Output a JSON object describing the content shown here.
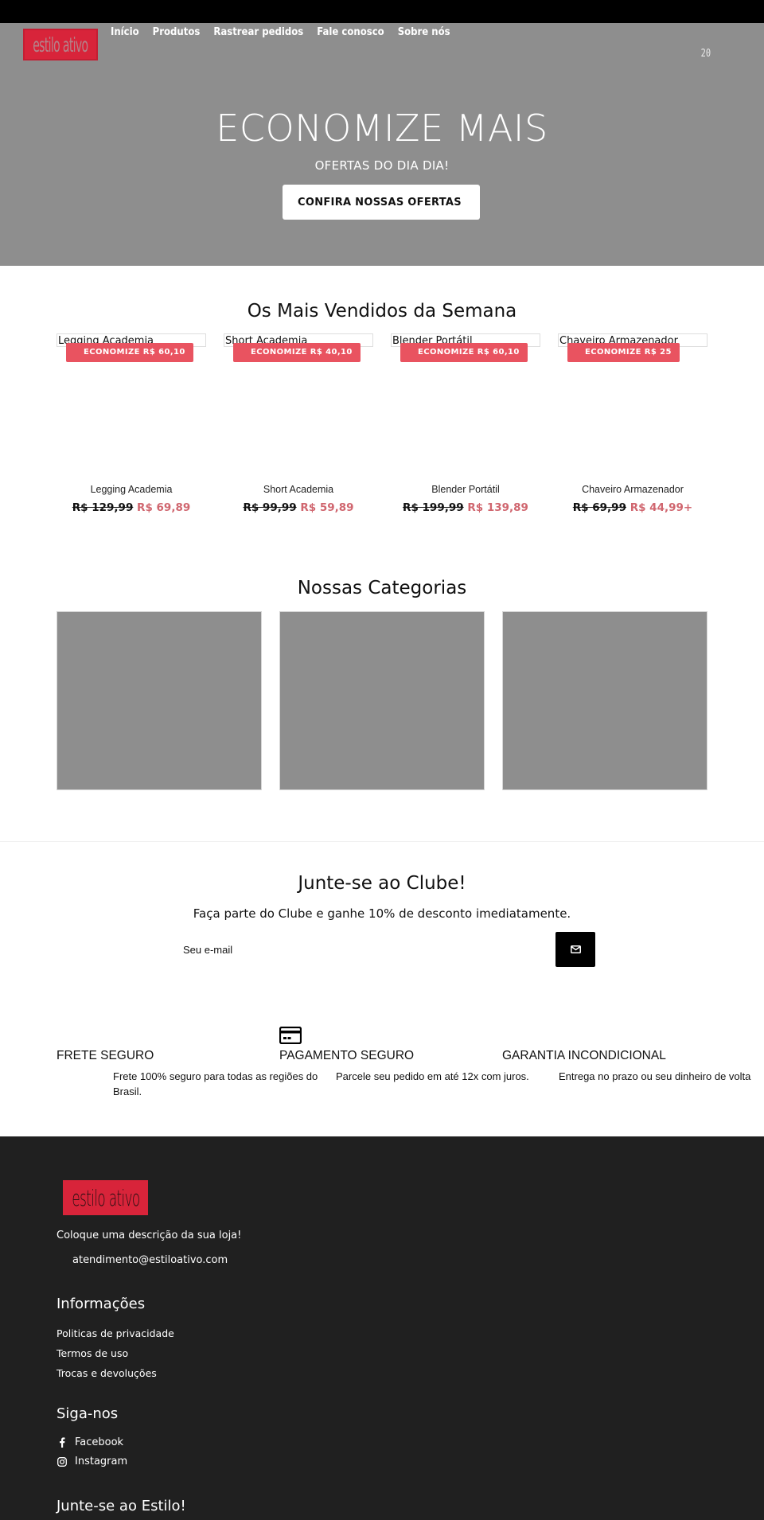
{
  "header": {
    "logo_text": "estilo ativo",
    "nav": [
      "Início",
      "Produtos",
      "Rastrear pedidos",
      "Fale conosco",
      "Sobre nós"
    ],
    "cart_count": "20"
  },
  "hero": {
    "title": "ECONOMIZE MAIS",
    "subtitle": "OFERTAS DO DIA DIA!",
    "cta_label": "CONFIRA NOSSAS OFERTAS"
  },
  "best_sellers": {
    "title": "Os Mais Vendidos da Semana",
    "products": [
      {
        "name": "Legging Academia",
        "badge": "ECONOMIZE R$ 60,10",
        "old_price": "R$ 129,99",
        "new_price": "R$ 69,89"
      },
      {
        "name": "Short Academia",
        "badge": "ECONOMIZE R$ 40,10",
        "old_price": "R$ 99,99",
        "new_price": "R$ 59,89"
      },
      {
        "name": "Blender Portátil",
        "badge": "ECONOMIZE R$ 60,10",
        "old_price": "R$ 199,99",
        "new_price": "R$ 139,89"
      },
      {
        "name": "Chaveiro Armazenador",
        "badge": "ECONOMIZE R$ 25",
        "old_price": "R$ 69,99",
        "new_price": "R$ 44,99+"
      }
    ]
  },
  "categories": {
    "title": "Nossas Categorias",
    "count": 3
  },
  "club": {
    "title": "Junte-se ao Clube!",
    "subtitle": "Faça parte do Clube e ganhe 10% de desconto imediatamente.",
    "email_placeholder": "Seu e-mail",
    "submit_icon": "envelope-icon"
  },
  "features": [
    {
      "title": "FRETE SEGURO",
      "desc": "Frete 100% seguro para todas as regiões do Brasil.",
      "icon": null
    },
    {
      "title": "PAGAMENTO SEGURO",
      "desc": "Parcele seu pedido em até 12x com juros.",
      "icon": "credit-card-icon"
    },
    {
      "title": "GARANTIA INCONDICIONAL",
      "desc": "Entrega no prazo ou seu dinheiro de volta",
      "icon": null
    }
  ],
  "footer": {
    "logo_text": "estilo ativo",
    "description": "Coloque uma descrição da sua loja!",
    "email": "atendimento@estiloativo.com",
    "info_title": "Informações",
    "info_links": [
      "Politicas de privacidade",
      "Termos de uso",
      "Trocas e devoluções"
    ],
    "social_title": "Siga-nos",
    "social_links": [
      {
        "label": "Facebook",
        "icon": "facebook-icon"
      },
      {
        "label": "Instagram",
        "icon": "instagram-icon"
      }
    ],
    "join_title": "Junte-se ao Estilo!"
  },
  "colors": {
    "brand_red": "#d8243a",
    "badge_red": "#e95360",
    "sale_price": "#d0666f",
    "hero_bg": "#8e8e8e",
    "footer_bg": "#202020"
  }
}
